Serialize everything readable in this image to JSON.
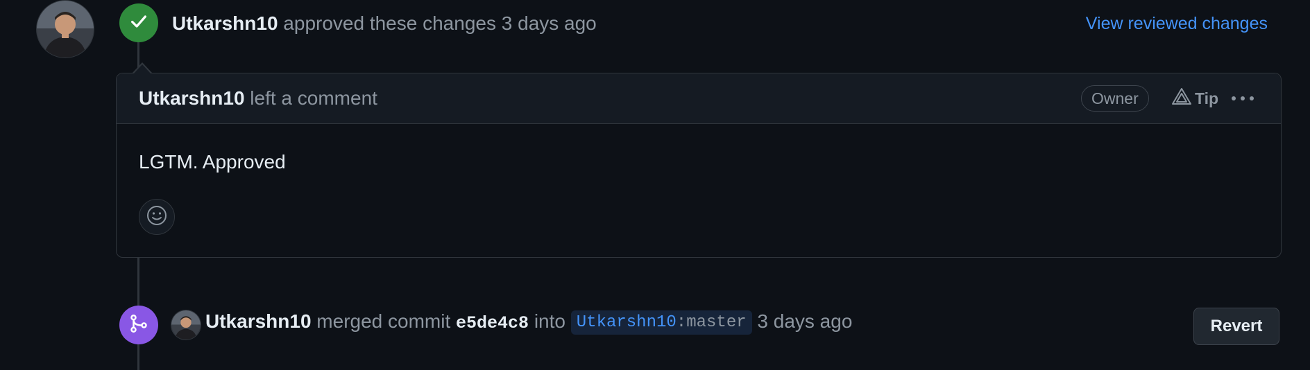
{
  "colors": {
    "background": "#0d1117",
    "approved_badge": "#2f8b3c",
    "merged_badge": "#8957e5",
    "link": "#4493f8",
    "muted_text": "#8d96a0",
    "primary_text": "#e6edf3"
  },
  "review_event": {
    "author": "Utkarshn10",
    "action": "approved these changes",
    "time": "3 days ago",
    "badge_icon": "check-icon",
    "view_link": "View reviewed changes"
  },
  "comment": {
    "author": "Utkarshn10",
    "action": "left a comment",
    "role_badge": "Owner",
    "tip_label": "Tip",
    "tip_icon": "copilot-triangle-icon",
    "more_icon": "kebab-horizontal-icon",
    "body": "LGTM. Approved",
    "reaction_icon": "smiley-icon"
  },
  "merge_event": {
    "author": "Utkarshn10",
    "action_prefix": "merged commit",
    "commit_sha": "e5de4c8",
    "into": "into",
    "branch_owner": "Utkarshn10",
    "branch_separator": ":",
    "branch_name": "master",
    "time": "3 days ago",
    "badge_icon": "git-merge-icon",
    "revert_label": "Revert"
  }
}
